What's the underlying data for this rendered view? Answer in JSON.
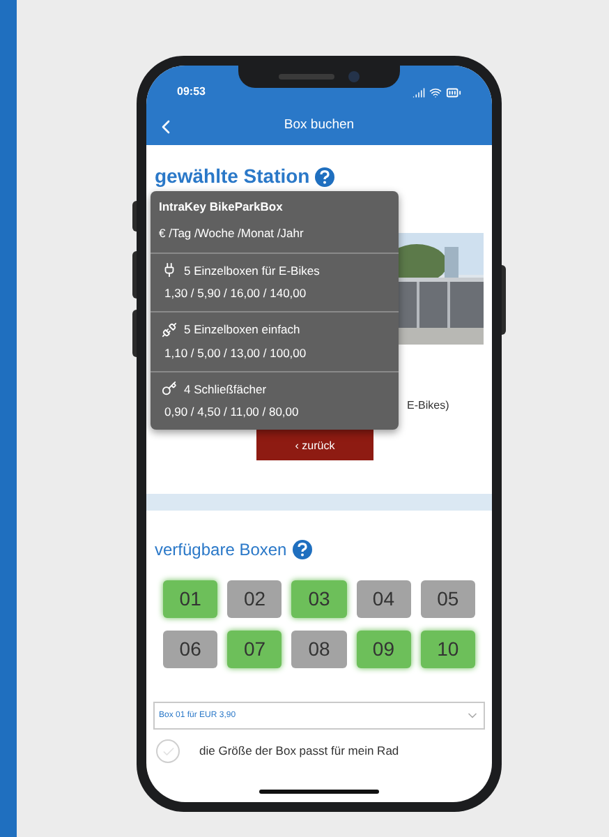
{
  "status_bar": {
    "time": "09:53"
  },
  "nav": {
    "title": "Box buchen"
  },
  "station": {
    "heading": "gewählte Station",
    "note": "E-Bikes)",
    "back_button": "‹ zurück"
  },
  "tooltip": {
    "title": "IntraKey BikeParkBox",
    "subtitle": "€ /Tag /Woche /Monat /Jahr",
    "items": [
      {
        "kind": "plug",
        "label": "5 Einzelboxen für E-Bikes",
        "prices": "1,30 / 5,90 / 16,00 / 140,00"
      },
      {
        "kind": "no-plug",
        "label": "5 Einzelboxen einfach",
        "prices": "1,10 / 5,00 / 13,00 / 100,00"
      },
      {
        "kind": "key",
        "label": "4 Schließfächer",
        "prices": "0,90 / 4,50 / 11,00 / 80,00"
      }
    ]
  },
  "boxes": {
    "heading": "verfügbare Boxen",
    "items": [
      {
        "label": "01",
        "available": true
      },
      {
        "label": "02",
        "available": false
      },
      {
        "label": "03",
        "available": true
      },
      {
        "label": "04",
        "available": false
      },
      {
        "label": "05",
        "available": false
      },
      {
        "label": "06",
        "available": false
      },
      {
        "label": "07",
        "available": true
      },
      {
        "label": "08",
        "available": false
      },
      {
        "label": "09",
        "available": true
      },
      {
        "label": "10",
        "available": true
      }
    ]
  },
  "select": {
    "value": "Box 01 für EUR 3,90"
  },
  "confirm": {
    "label": "die Größe der Box passt für mein Rad",
    "checked": false
  }
}
